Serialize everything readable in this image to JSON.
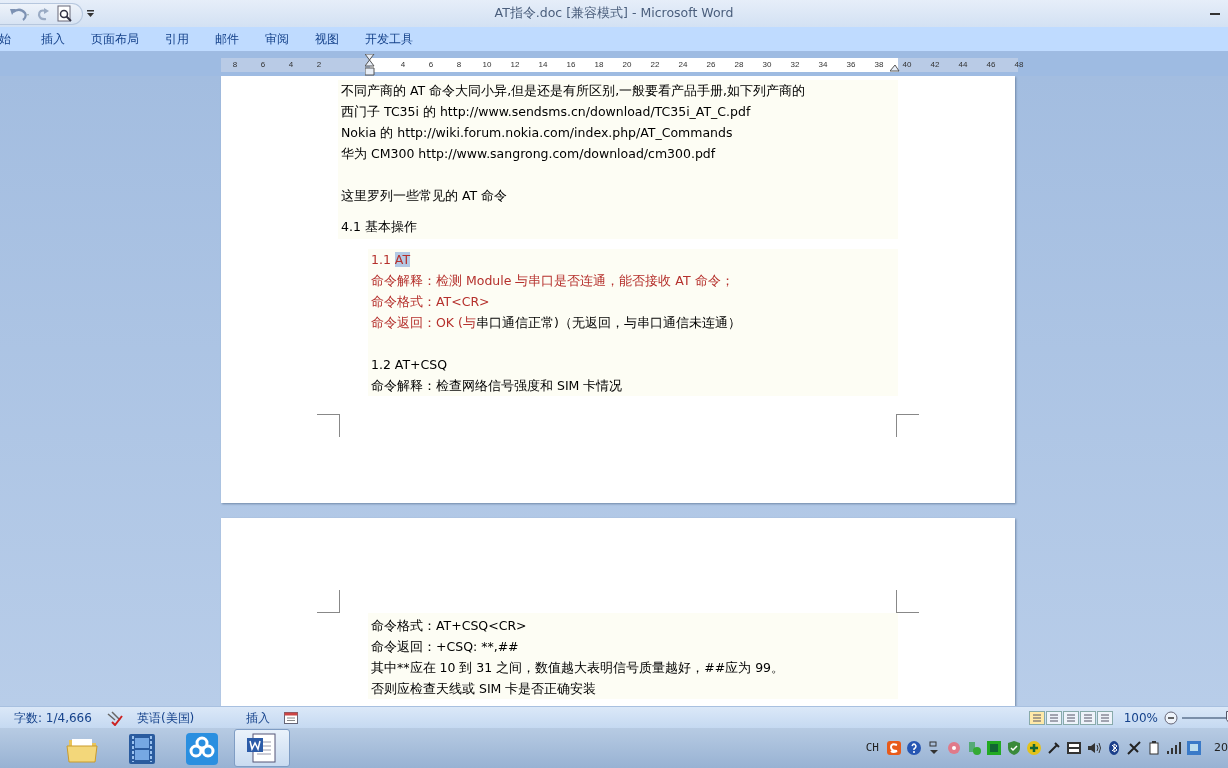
{
  "window": {
    "title": "AT指令.doc [兼容模式] - Microsoft Word"
  },
  "ribbon_tabs": [
    {
      "label": "始"
    },
    {
      "label": "插入"
    },
    {
      "label": "页面布局"
    },
    {
      "label": "引用"
    },
    {
      "label": "邮件"
    },
    {
      "label": "审阅"
    },
    {
      "label": "视图"
    },
    {
      "label": "开发工具"
    }
  ],
  "ruler": {
    "left_numbers": [
      "8",
      "6",
      "4",
      "2"
    ],
    "right_numbers": [
      "4",
      "6",
      "8",
      "10",
      "12",
      "14",
      "16",
      "18",
      "20",
      "22",
      "24",
      "26",
      "28",
      "30",
      "32",
      "34",
      "36",
      "38",
      "40",
      "42",
      "44",
      "46",
      "48"
    ]
  },
  "pages": [
    {
      "blocks": [
        {
          "kind": "body",
          "lines": [
            {
              "kind": "text",
              "segments": [
                {
                  "text": "不同产商的 AT 命令大同小异,但是还是有所区别,一般要看产品手册,如下列产商的",
                  "color": "#000000",
                  "selected": false
                }
              ]
            },
            {
              "kind": "text",
              "segments": [
                {
                  "text": "西门子  TC35i  的  http://www.sendsms.cn/download/TC35i_AT_C.pdf",
                  "color": "#000000",
                  "selected": false
                }
              ]
            },
            {
              "kind": "text",
              "segments": [
                {
                  "text": "Nokia 的  http://wiki.forum.nokia.com/index.php/AT_Commands",
                  "color": "#000000",
                  "selected": false
                }
              ]
            },
            {
              "kind": "text",
              "segments": [
                {
                  "text": "华为 CM300  http://www.sangrong.com/download/cm300.pdf",
                  "color": "#000000",
                  "selected": false
                }
              ]
            },
            {
              "kind": "blank"
            },
            {
              "kind": "text",
              "segments": [
                {
                  "text": "这里罗列一些常见的 AT 命令",
                  "color": "#000000",
                  "selected": false
                }
              ]
            },
            {
              "kind": "heading",
              "segments": [
                {
                  "text": "4.1  基本操作",
                  "color": "#000000",
                  "selected": false
                }
              ]
            }
          ]
        },
        {
          "kind": "indented",
          "lines": [
            {
              "kind": "text",
              "segments": [
                {
                  "text": "1.1 ",
                  "color": "#b5302c",
                  "selected": false
                },
                {
                  "text": "AT",
                  "color": "#b5302c",
                  "selected": true
                }
              ]
            },
            {
              "kind": "text",
              "segments": [
                {
                  "text": "命令解释：检测 Module 与串口是否连通，能否接收 AT 命令；",
                  "color": "#b5302c",
                  "selected": false
                }
              ]
            },
            {
              "kind": "text",
              "segments": [
                {
                  "text": "命令格式：AT<CR>",
                  "color": "#b5302c",
                  "selected": false
                }
              ]
            },
            {
              "kind": "text",
              "segments": [
                {
                  "text": "命令返回：OK (与",
                  "color": "#b5302c",
                  "selected": false
                },
                {
                  "text": "串口通信正常)（无返回，与串口通信未连通）",
                  "color": "#000000",
                  "selected": false
                }
              ]
            },
            {
              "kind": "blank"
            },
            {
              "kind": "text",
              "segments": [
                {
                  "text": "1.2 AT+CSQ",
                  "color": "#000000",
                  "selected": false
                }
              ]
            },
            {
              "kind": "text",
              "segments": [
                {
                  "text": "命令解释：检查网络信号强度和 SIM 卡情况",
                  "color": "#000000",
                  "selected": false
                }
              ]
            }
          ]
        }
      ]
    },
    {
      "blocks": [
        {
          "kind": "indented",
          "lines": [
            {
              "kind": "text",
              "segments": [
                {
                  "text": "命令格式：AT+CSQ<CR>",
                  "color": "#000000",
                  "selected": false
                }
              ]
            },
            {
              "kind": "text",
              "segments": [
                {
                  "text": "命令返回：+CSQ: **,##",
                  "color": "#000000",
                  "selected": false
                }
              ]
            },
            {
              "kind": "text",
              "segments": [
                {
                  "text": "其中**应在 10 到 31 之间，数值越大表明信号质量越好，##应为 99。",
                  "color": "#000000",
                  "selected": false
                }
              ]
            },
            {
              "kind": "text",
              "segments": [
                {
                  "text": "否则应检查天线或 SIM 卡是否正确安装",
                  "color": "#000000",
                  "selected": false
                }
              ]
            }
          ]
        }
      ]
    }
  ],
  "status_bar": {
    "word_count": "字数: 1/4,666",
    "language": "英语(美国)",
    "mode": "插入",
    "zoom": "100%",
    "zoom_slider": {
      "level": 0.5
    }
  },
  "taskbar": {
    "apps": [
      {
        "kind": "folder",
        "selected": false
      },
      {
        "kind": "film",
        "selected": false
      },
      {
        "kind": "cloud",
        "selected": false
      },
      {
        "kind": "word",
        "selected": true
      }
    ],
    "input_method": "CH",
    "clock": "20"
  }
}
